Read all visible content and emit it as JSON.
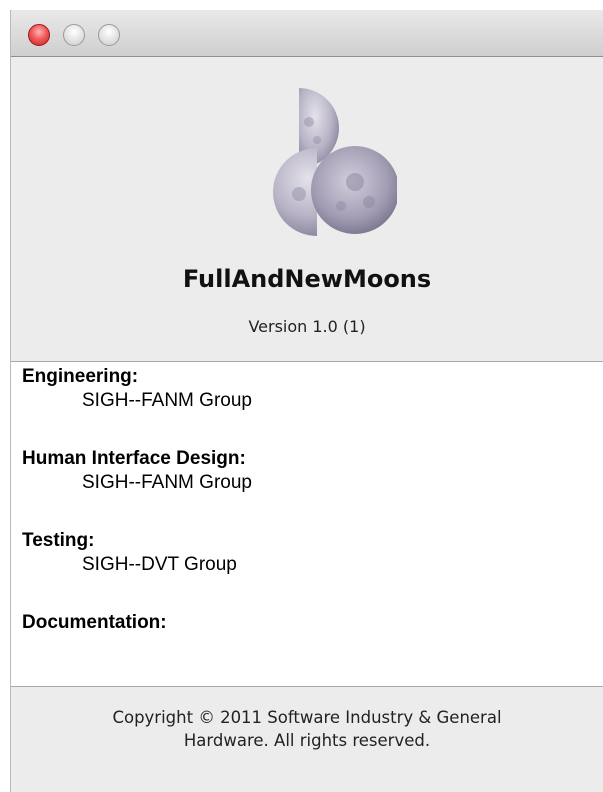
{
  "window": {
    "traffic_lights": [
      "close-button",
      "minimize-button",
      "zoom-button"
    ]
  },
  "app": {
    "icon": "moons-icon",
    "name": "FullAndNewMoons",
    "version": "Version 1.0 (1)"
  },
  "credits": [
    {
      "heading": "Engineering:",
      "value": "SIGH--FANM Group"
    },
    {
      "heading": "Human Interface Design:",
      "value": "SIGH--FANM Group"
    },
    {
      "heading": "Testing:",
      "value": "SIGH--DVT Group"
    },
    {
      "heading": "Documentation:",
      "value": ""
    }
  ],
  "copyright": {
    "line1": "Copyright © 2011 Software Industry & General",
    "line2": "Hardware. All rights reserved."
  }
}
